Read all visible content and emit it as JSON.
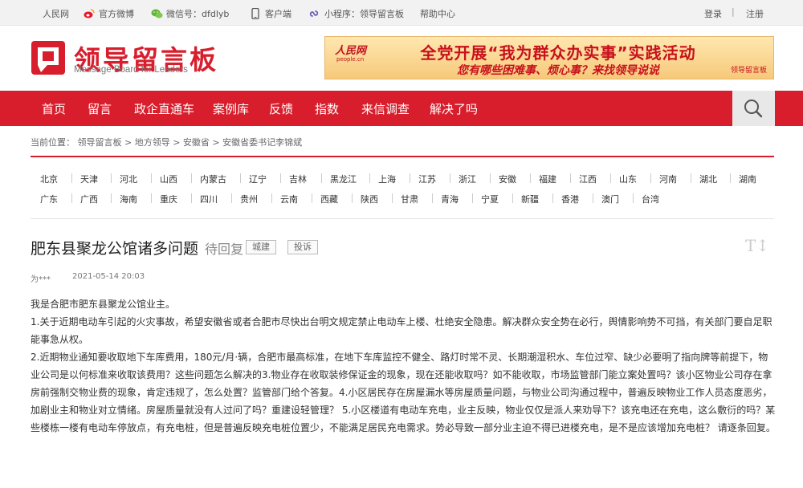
{
  "topbar": {
    "site": "人民网",
    "weibo": "官方微博",
    "wechat": "微信号：dfdlyb",
    "client": "客户端",
    "miniprogram": "小程序：领导留言板",
    "help": "帮助中心",
    "login": "登录",
    "sep": "|",
    "register": "注册"
  },
  "header": {
    "logo_title": "领导留言板",
    "logo_sub": "Message Board for Leaders"
  },
  "banner": {
    "brand": "人民网",
    "brand_url": "people.cn",
    "line1": "全党开展“我为群众办实事”实践活动",
    "line2": "您有哪些困难事、烦心事？来找领导说说",
    "tag": "领导留言板"
  },
  "nav": {
    "items": [
      "首页",
      "留言",
      "政企直通车",
      "案例库",
      "反馈",
      "指数",
      "来信调查",
      "解决了吗"
    ]
  },
  "breadcrumb": "当前位置：  领导留言板 > 地方领导 > 安徽省 > 安徽省委书记李锦斌",
  "provinces": {
    "row1": [
      "北京",
      "天津",
      "河北",
      "山西",
      "内蒙古",
      "辽宁",
      "吉林",
      "黑龙江",
      "上海",
      "江苏",
      "浙江",
      "安徽",
      "福建",
      "江西",
      "山东",
      "河南",
      "湖北",
      "湖南"
    ],
    "row2": [
      "广东",
      "广西",
      "海南",
      "重庆",
      "四川",
      "贵州",
      "云南",
      "西藏",
      "陕西",
      "甘肃",
      "青海",
      "宁夏",
      "新疆",
      "香港",
      "澳门",
      "台湾"
    ]
  },
  "post": {
    "title": "肥东县聚龙公馆诸多问题",
    "status": "待回复",
    "tags": [
      "城建",
      "投诉"
    ],
    "font_tool": "T↕",
    "author": "为***",
    "time": "2021-05-14 20:03",
    "paragraphs": [
      "我是合肥市肥东县聚龙公馆业主。",
      "1.关于近期电动车引起的火灾事故，希望安徽省或者合肥市尽快出台明文规定禁止电动车上楼、杜绝安全隐患。解决群众安全势在必行，舆情影响势不可挡，有关部门要自足职能事急从权。",
      "2.近期物业通知要收取地下车库费用，180元/月·辆，合肥市最高标准，在地下车库监控不健全、路灯时常不灵、长期潮湿积水、车位过窄、缺少必要明了指向牌等前提下，物业公司是以何标准来收取该费用？这些问题怎么解决的3.物业存在收取装修保证金的现象，现在还能收取吗？如不能收取，市场监管部门能立案处置吗？该小区物业公司存在拿房前强制交物业费的现象，肯定违规了，怎么处置？监管部门给个答复。4.小区居民存在房屋漏水等房屋质量问题，与物业公司沟通过程中，普遍反映物业工作人员态度恶劣，加剧业主和物业对立情绪。房屋质量就没有人过问了吗？重建设轻管理？ 5.小区楼道有电动车充电，业主反映，物业仅仅是派人来劝导下？该充电还在充电，这么敷衍的吗？某些楼栋一楼有电动车停放点，有充电桩，但是普遍反映充电桩位置少，不能满足居民充电需求。势必导致一部分业主迫不得已进楼充电，是不是应该增加充电桩？ 请逐条回复。"
    ]
  },
  "colors": {
    "brand_red": "#d81e2c",
    "topbar_bg": "#f2f2f2"
  },
  "icons": [
    "weibo-icon",
    "wechat-icon",
    "phone-icon",
    "miniprogram-icon",
    "search-icon",
    "font-size-icon"
  ]
}
